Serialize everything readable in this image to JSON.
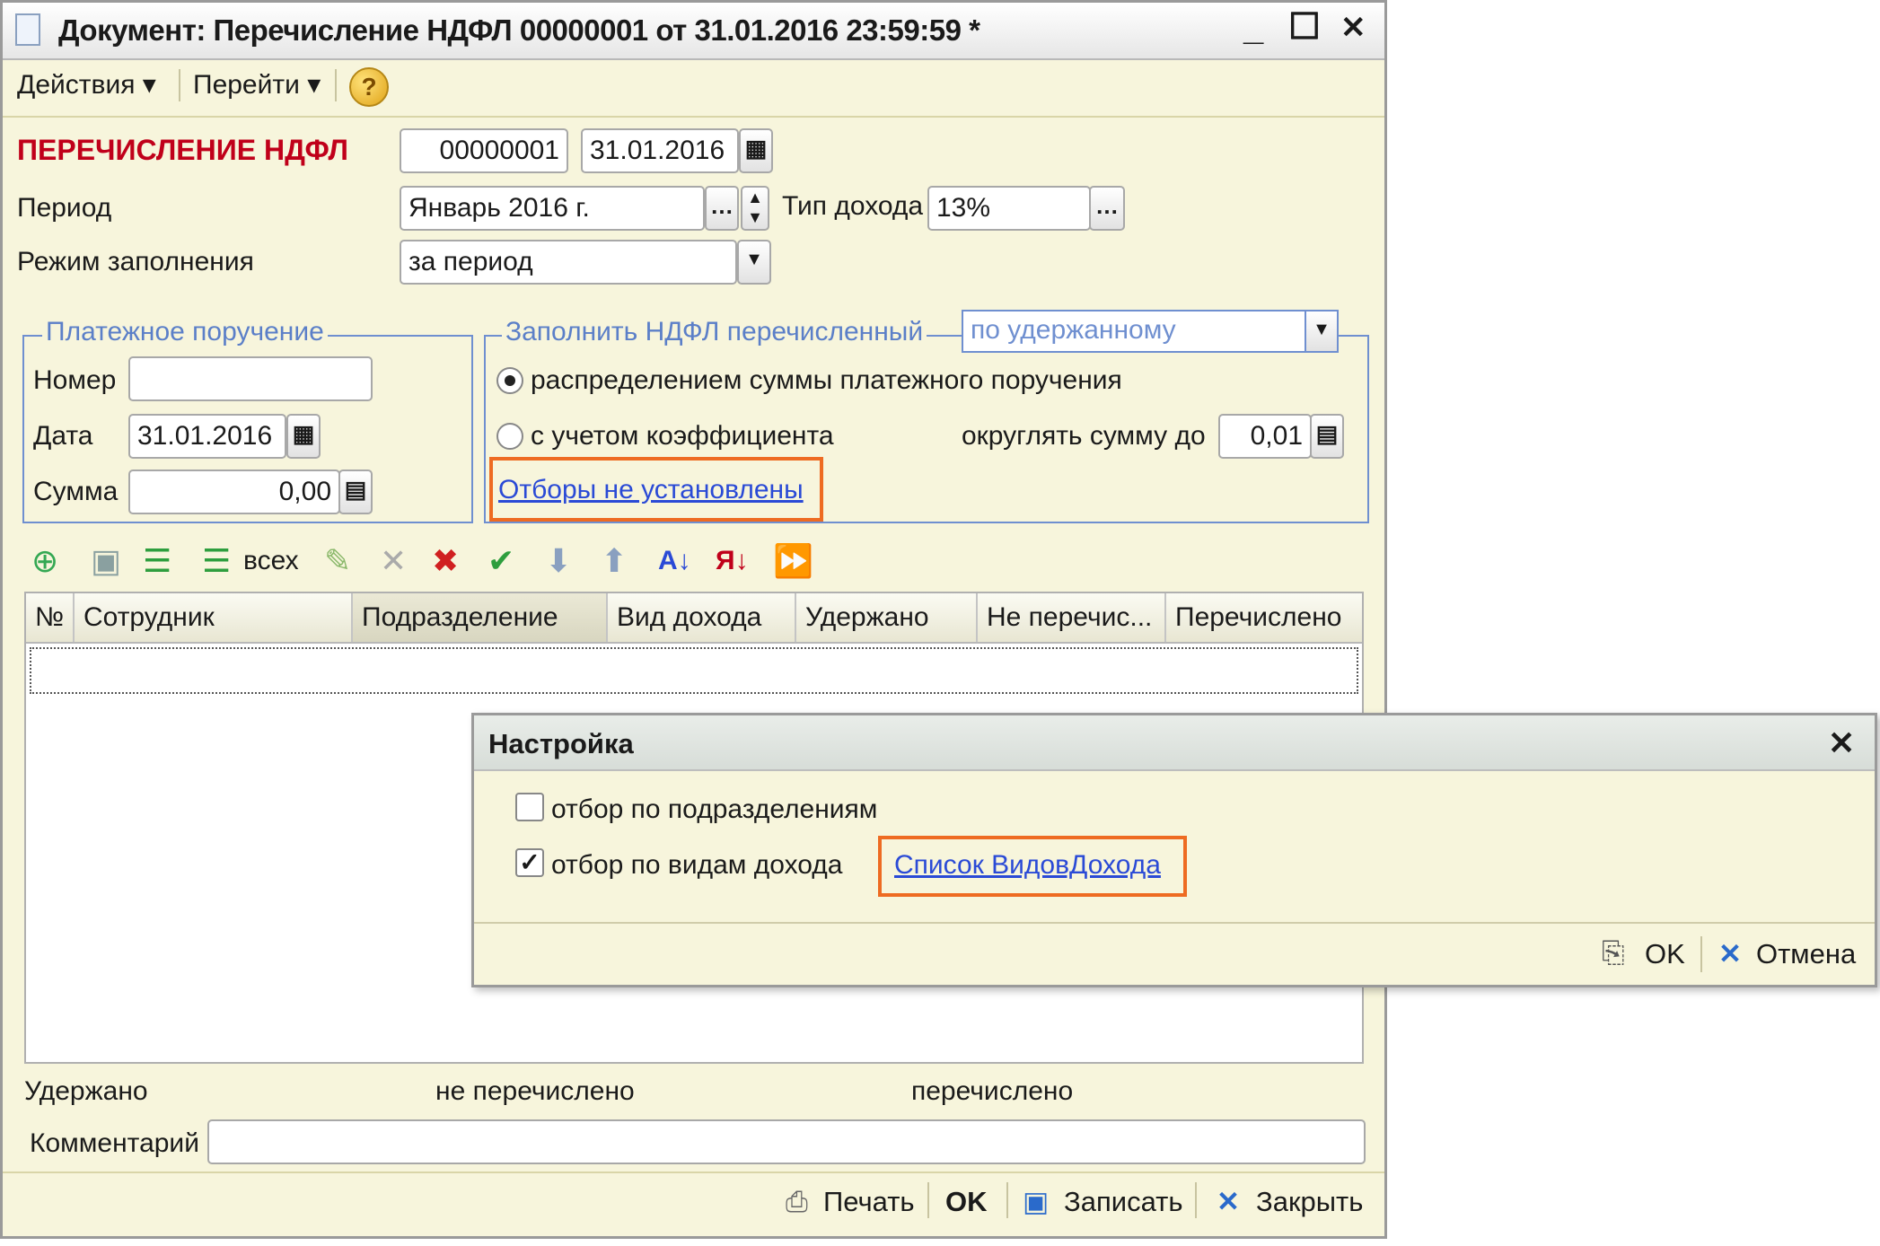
{
  "window": {
    "title": "Документ: Перечисление НДФЛ 00000001 от 31.01.2016 23:59:59 *",
    "minimize": "_",
    "maximize": "☐",
    "close": "✕"
  },
  "menu": {
    "actions": "Действия ▾",
    "goto": "Перейти ▾",
    "help": "?"
  },
  "header": {
    "doc_type": "ПЕРЕЧИСЛЕНИЕ НДФЛ",
    "number": "00000001",
    "date": "31.01.2016",
    "period_label": "Период",
    "period_value": "Январь 2016 г.",
    "income_type_label": "Тип дохода",
    "income_type_value": "13%",
    "fill_mode_label": "Режим заполнения",
    "fill_mode_value": "за период"
  },
  "payment_order": {
    "title": "Платежное поручение",
    "number_label": "Номер",
    "number_value": "",
    "date_label": "Дата",
    "date_value": "31.01.2016",
    "sum_label": "Сумма",
    "sum_value": "0,00"
  },
  "fill_ndfl": {
    "title": "Заполнить НДФЛ перечисленный",
    "mode_value": "по удержанному",
    "radio_distribute": "распределением суммы платежного поручения",
    "radio_coefficient": "с учетом коэффициента",
    "round_label": "округлять сумму до",
    "round_value": "0,01",
    "filters_link": "Отборы не установлены"
  },
  "toolbar": {
    "all_label": "всех"
  },
  "table": {
    "columns": [
      "№",
      "Сотрудник",
      "Подразделение",
      "Вид дохода",
      "Удержано",
      "Не перечис...",
      "Перечислено"
    ]
  },
  "totals": {
    "withheld": "Удержано",
    "not_transferred": "не перечислено",
    "transferred": "перечислено"
  },
  "comment": {
    "label": "Комментарий",
    "value": ""
  },
  "footer": {
    "print": "Печать",
    "ok": "OK",
    "save": "Записать",
    "close": "Закрыть"
  },
  "dialog": {
    "title": "Настройка",
    "close": "✕",
    "filter_departments": "отбор по подразделениям",
    "filter_departments_checked": false,
    "filter_income_types": "отбор по видам дохода",
    "filter_income_types_checked": true,
    "income_types_link": "Список ВидовДохода",
    "ok": "OK",
    "cancel": "Отмена"
  },
  "colors": {
    "accent_red": "#c0001a",
    "group_blue": "#6f8fd0",
    "highlight_orange": "#ee6b22",
    "link_blue": "#2a4ad6"
  }
}
